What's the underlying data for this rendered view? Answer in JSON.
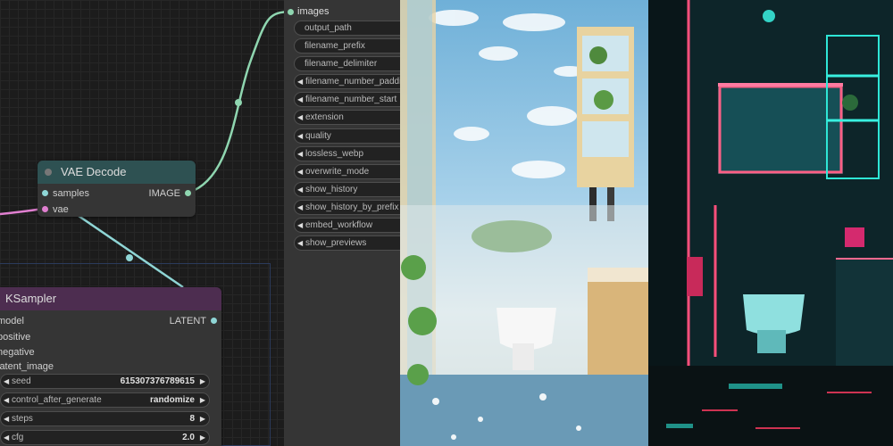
{
  "vae_node": {
    "title": "VAE Decode",
    "inputs": [
      "samples",
      "vae"
    ],
    "output": "IMAGE"
  },
  "ksampler": {
    "title": "KSampler",
    "inputs": [
      "model",
      "positive",
      "negative",
      "latent_image"
    ],
    "output": "LATENT",
    "widgets": [
      {
        "label": "seed",
        "value": "615307376789615"
      },
      {
        "label": "control_after_generate",
        "value": "randomize"
      },
      {
        "label": "steps",
        "value": "8"
      },
      {
        "label": "cfg",
        "value": "2.0"
      }
    ]
  },
  "save_panel": {
    "input": "images",
    "widgets": [
      {
        "label": "output_path",
        "kind": "text"
      },
      {
        "label": "filename_prefix",
        "kind": "text"
      },
      {
        "label": "filename_delimiter",
        "kind": "text"
      },
      {
        "label": "filename_number_padding",
        "kind": "number"
      },
      {
        "label": "filename_number_start",
        "kind": "number"
      },
      {
        "label": "extension",
        "kind": "combo"
      },
      {
        "label": "quality",
        "kind": "number"
      },
      {
        "label": "lossless_webp",
        "kind": "toggle"
      },
      {
        "label": "overwrite_mode",
        "kind": "combo"
      },
      {
        "label": "show_history",
        "kind": "toggle"
      },
      {
        "label": "show_history_by_prefix",
        "kind": "toggle"
      },
      {
        "label": "embed_workflow",
        "kind": "toggle"
      },
      {
        "label": "show_previews",
        "kind": "toggle"
      }
    ]
  },
  "colors": {
    "image_wire": "#8fd6b0",
    "latent_wire": "#8fd6d6",
    "vae_wire": "#e07fd0",
    "vae_title_bg": "#2e5152",
    "ksampler_title_bg": "#4d2d50"
  },
  "preview_images": [
    {
      "name": "pastel-sky-bathroom"
    },
    {
      "name": "neon-cyber-bathroom"
    }
  ]
}
